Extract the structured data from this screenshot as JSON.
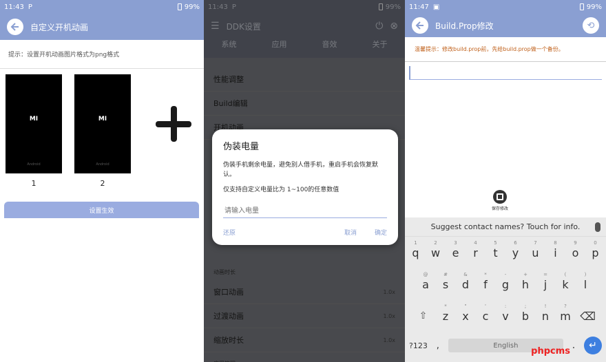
{
  "panel1": {
    "status": {
      "time": "11:43",
      "battery": "99%"
    },
    "title": "自定义开机动画",
    "hint": "提示：设置开机动画图片格式为png格式",
    "thumbs": [
      {
        "num": "1",
        "logo": "MI"
      },
      {
        "num": "2",
        "logo": "MI"
      }
    ],
    "apply_label": "设置生效"
  },
  "panel2": {
    "status": {
      "time": "11:43",
      "battery": "99%"
    },
    "title": "DDK设置",
    "tabs": [
      "系统",
      "应用",
      "音效",
      "关于"
    ],
    "rows_top": [
      "性能调整",
      "Build编辑",
      "开机动画"
    ],
    "section": "动画时长",
    "rows_bottom": [
      {
        "label": "窗口动画",
        "value": "1.0x"
      },
      {
        "label": "过渡动画",
        "value": "1.0x"
      },
      {
        "label": "缩放时长",
        "value": "1.0x"
      }
    ],
    "section2": "应用管理",
    "dialog": {
      "title": "伪装电量",
      "desc": "伪装手机剩余电量，避免别人借手机，重启手机会恢复默认。",
      "note": "仅支持自定义电量比为 1~100的任意数值",
      "placeholder": "请输入电量",
      "restore": "还原",
      "cancel": "取消",
      "confirm": "确定"
    }
  },
  "panel3": {
    "status": {
      "time": "11:47",
      "battery": "99%"
    },
    "title": "Build.Prop修改",
    "warn": "温馨提示：修改build.prop前，先给build.prop做一个备份。",
    "save_label": "保存修改",
    "keyboard": {
      "suggest": "Suggest contact names? Touch for info.",
      "row1": [
        [
          "q",
          "1"
        ],
        [
          "w",
          "2"
        ],
        [
          "e",
          "3"
        ],
        [
          "r",
          "4"
        ],
        [
          "t",
          "5"
        ],
        [
          "y",
          "6"
        ],
        [
          "u",
          "7"
        ],
        [
          "i",
          "8"
        ],
        [
          "o",
          "9"
        ],
        [
          "p",
          "0"
        ]
      ],
      "row2": [
        [
          "a",
          "@"
        ],
        [
          "s",
          "#"
        ],
        [
          "d",
          "&"
        ],
        [
          "f",
          "*"
        ],
        [
          "g",
          "-"
        ],
        [
          "h",
          "+"
        ],
        [
          "j",
          "="
        ],
        [
          "k",
          "("
        ],
        [
          "l",
          ")"
        ]
      ],
      "row3": [
        [
          "z",
          "*"
        ],
        [
          "x",
          "\""
        ],
        [
          "c",
          "'"
        ],
        [
          "v",
          ":"
        ],
        [
          "b",
          ";"
        ],
        [
          "n",
          "!"
        ],
        [
          "m",
          "?"
        ]
      ],
      "sym": "?123",
      "comma": ",",
      "space": "English"
    }
  },
  "watermark": "phpcms",
  "colors": {
    "appbar": "#8a9fd2",
    "warn": "#c0601a",
    "enter": "#3d7fe0"
  }
}
